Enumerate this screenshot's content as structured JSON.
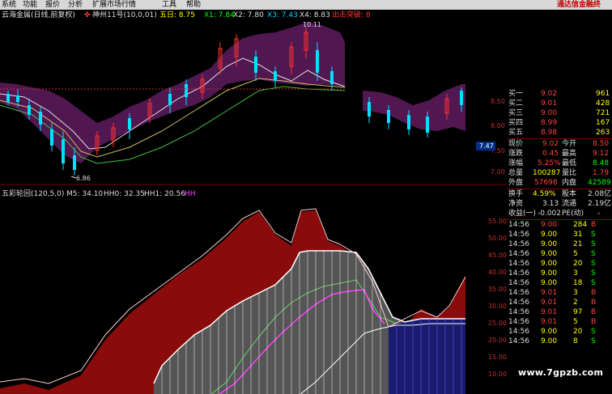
{
  "menu": {
    "items": [
      "系统",
      "功能",
      "报价",
      "分析",
      "扩展市场行情",
      "工具",
      "帮助"
    ],
    "promo": "通达信金融终"
  },
  "header_top": {
    "title": "云海金属(日线,前复权)",
    "indicator": "神州11号(10,0,01)",
    "ma5": "五日: 8.75",
    "x1": "X1: 7.84",
    "x2": "X2: 7.80",
    "x3": "X3: 7.43",
    "x4": "X4: 8.83",
    "signal": "出击突破: 8"
  },
  "top_chart_labels": {
    "high_mark": "10.11",
    "low_mark": "6.86",
    "y_ticks": [
      "8.50",
      "8.00",
      "7.50",
      "7.00"
    ],
    "current_price_box": "7.47"
  },
  "header_bottom": {
    "name": "五彩轮回(120,5,0)",
    "m5": "M5: 34.10",
    "hh0": "HH0: 32.35",
    "hh1": "HH1: 20.56",
    "hh": "HH"
  },
  "bottom_y_ticks": [
    "55.00",
    "50.00",
    "45.00",
    "40.00",
    "35.00",
    "30.00",
    "25.00",
    "20.00",
    "15.00",
    "10.00"
  ],
  "order_book": [
    {
      "label": "买一",
      "price": "9.02",
      "vol": "961"
    },
    {
      "label": "买二",
      "price": "9.01",
      "vol": "428"
    },
    {
      "label": "买三",
      "price": "9.00",
      "vol": "721"
    },
    {
      "label": "买四",
      "price": "8.99",
      "vol": "167"
    },
    {
      "label": "买五",
      "price": "8.98",
      "vol": "263"
    }
  ],
  "stats": [
    {
      "l1": "现价",
      "v1": "9.02",
      "l2": "今开",
      "v2": "8.50"
    },
    {
      "l1": "涨跌",
      "v1": "0.45",
      "l2": "最高",
      "v2": "9.12"
    },
    {
      "l1": "涨幅",
      "v1": "5.25%",
      "l2": "最低",
      "v2": "8.48"
    },
    {
      "l1": "总量",
      "v1": "100287",
      "l2": "量比",
      "v2": "1.79"
    },
    {
      "l1": "外盘",
      "v1": "57698",
      "l2": "内盘",
      "v2": "42589"
    },
    {
      "l1": "换手",
      "v1": "4.59%",
      "l2": "股本",
      "v2": "2.08亿"
    },
    {
      "l1": "净资",
      "v1": "3.13",
      "l2": "流通",
      "v2": "2.19亿"
    },
    {
      "l1": "收益(一)",
      "v1": "-0.002",
      "l2": "PE(动)",
      "v2": "-"
    }
  ],
  "ticks": [
    {
      "time": "14:56",
      "price": "9.00",
      "vol": "284",
      "dir": "B"
    },
    {
      "time": "14:56",
      "price": "9.00",
      "vol": "31",
      "dir": "S"
    },
    {
      "time": "14:56",
      "price": "9.00",
      "vol": "21",
      "dir": "S"
    },
    {
      "time": "14:56",
      "price": "9.00",
      "vol": "5",
      "dir": "S"
    },
    {
      "time": "14:56",
      "price": "9.00",
      "vol": "20",
      "dir": "S"
    },
    {
      "time": "14:56",
      "price": "9.00",
      "vol": "3",
      "dir": "S"
    },
    {
      "time": "14:56",
      "price": "9.00",
      "vol": "18",
      "dir": "S"
    },
    {
      "time": "14:56",
      "price": "9.01",
      "vol": "3",
      "dir": "B"
    },
    {
      "time": "14:56",
      "price": "9.01",
      "vol": "2",
      "dir": "B"
    },
    {
      "time": "14:56",
      "price": "9.01",
      "vol": "97",
      "dir": "B"
    },
    {
      "time": "14:56",
      "price": "9.01",
      "vol": "5",
      "dir": "B"
    },
    {
      "time": "14:56",
      "price": "9.00",
      "vol": "20",
      "dir": "S"
    },
    {
      "time": "14:56",
      "price": "9.00",
      "vol": "8",
      "dir": "S"
    }
  ],
  "watermark": "www.7gpzb.com"
}
